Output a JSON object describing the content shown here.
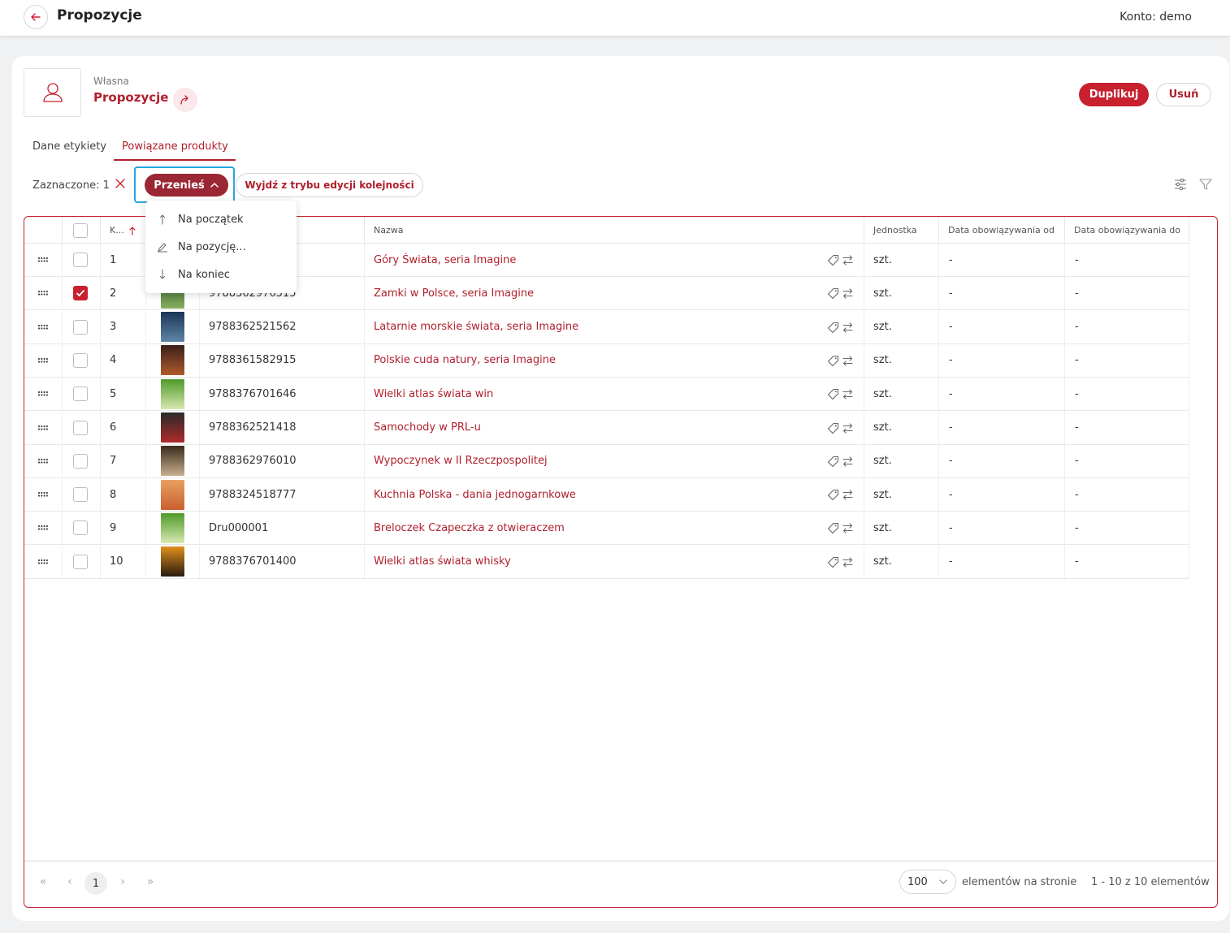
{
  "header": {
    "title": "Propozycje",
    "account": "Konto: demo"
  },
  "label": {
    "type": "Własna",
    "name": "Propozycje"
  },
  "actions": {
    "duplicate": "Duplikuj",
    "delete": "Usuń"
  },
  "tabs": [
    {
      "label": "Dane etykiety",
      "active": false
    },
    {
      "label": "Powiązane produkty",
      "active": true
    }
  ],
  "toolbar": {
    "selected": "Zaznaczone: 1",
    "move": "Przenieś",
    "exit": "Wyjdź z trybu edycji kolejności"
  },
  "move_menu": [
    {
      "label": "Na początek",
      "icon": "arrow-up-icon"
    },
    {
      "label": "Na pozycję...",
      "icon": "pencil-position-icon"
    },
    {
      "label": "Na koniec",
      "icon": "arrow-down-icon"
    }
  ],
  "table": {
    "columns": {
      "order": "K...",
      "code": "",
      "name": "Nazwa",
      "unit": "Jednostka",
      "date_from": "Data obowiązywania od",
      "date_to": "Data obowiązywania do"
    },
    "rows": [
      {
        "pos": "1",
        "code": "",
        "name": "Góry Świata, seria Imagine",
        "unit": "szt.",
        "from": "-",
        "to": "-",
        "checked": false,
        "thumb": [
          "#3a5f2a",
          "#7fa35a"
        ]
      },
      {
        "pos": "2",
        "code": "9788362976515",
        "name": "Zamki w Polsce, seria Imagine",
        "unit": "szt.",
        "from": "-",
        "to": "-",
        "checked": true,
        "thumb": [
          "#2f5a2c",
          "#88b060"
        ]
      },
      {
        "pos": "3",
        "code": "9788362521562",
        "name": "Latarnie morskie świata, seria Imagine",
        "unit": "szt.",
        "from": "-",
        "to": "-",
        "checked": false,
        "thumb": [
          "#1b3556",
          "#5f86a8"
        ]
      },
      {
        "pos": "4",
        "code": "9788361582915",
        "name": "Polskie cuda natury, seria Imagine",
        "unit": "szt.",
        "from": "-",
        "to": "-",
        "checked": false,
        "thumb": [
          "#3a1f1a",
          "#b05a2a"
        ]
      },
      {
        "pos": "5",
        "code": "9788376701646",
        "name": "Wielki atlas świata win",
        "unit": "szt.",
        "from": "-",
        "to": "-",
        "checked": false,
        "thumb": [
          "#4f9a2a",
          "#d8e8b0"
        ]
      },
      {
        "pos": "6",
        "code": "9788362521418",
        "name": "Samochody w PRL-u",
        "unit": "szt.",
        "from": "-",
        "to": "-",
        "checked": false,
        "thumb": [
          "#2a2a2a",
          "#b02a2a"
        ]
      },
      {
        "pos": "7",
        "code": "9788362976010",
        "name": "Wypoczynek w II Rzeczpospolitej",
        "unit": "szt.",
        "from": "-",
        "to": "-",
        "checked": false,
        "thumb": [
          "#3a2a1a",
          "#c8b090"
        ]
      },
      {
        "pos": "8",
        "code": "9788324518777",
        "name": "Kuchnia Polska - dania jednogarnkowe",
        "unit": "szt.",
        "from": "-",
        "to": "-",
        "checked": false,
        "thumb": [
          "#e8a060",
          "#c86030"
        ]
      },
      {
        "pos": "9",
        "code": "Dru000001",
        "name": "Breloczek Czapeczka z otwieraczem",
        "unit": "szt.",
        "from": "-",
        "to": "-",
        "checked": false,
        "thumb": [
          "#4f9a2a",
          "#d8e8b0"
        ]
      },
      {
        "pos": "10",
        "code": "9788376701400",
        "name": "Wielki atlas świata whisky",
        "unit": "szt.",
        "from": "-",
        "to": "-",
        "checked": false,
        "thumb": [
          "#e0901a",
          "#2a1a10"
        ]
      }
    ]
  },
  "pagination": {
    "current": "1",
    "per_page": "100",
    "per_page_label": "elementów na stronie",
    "total": "1 - 10 z 10 elementów"
  },
  "colors": {
    "accent": "#c8202e",
    "accent_dark": "#9a2733",
    "focus": "#28a6de"
  }
}
